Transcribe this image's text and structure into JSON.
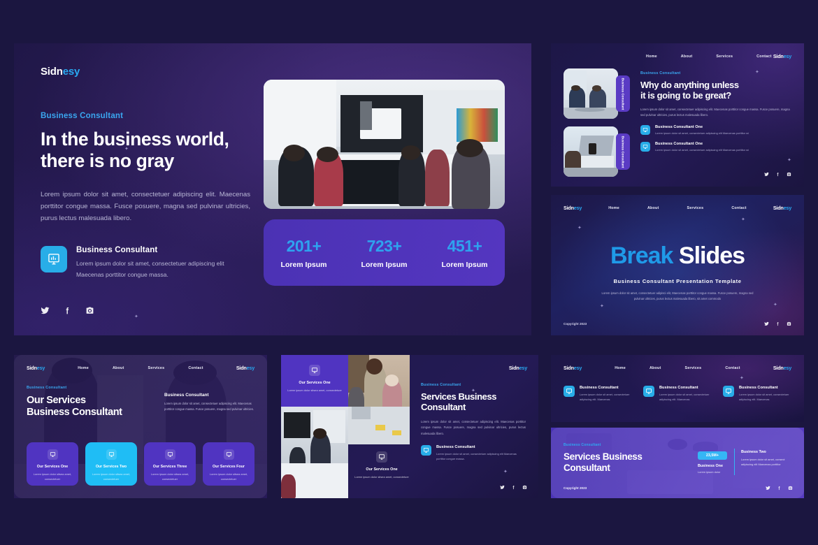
{
  "brand": {
    "logo_prefix": "Sidn",
    "logo_suffix": "esy",
    "accent": "#29a9f2",
    "purple": "#5034c1",
    "bg": "#1b1640"
  },
  "nav": {
    "items": [
      "Home",
      "About",
      "Services",
      "Contact"
    ]
  },
  "hero": {
    "logo_prefix": "Sidn",
    "logo_suffix": "esy",
    "eyebrow": "Business Consultant",
    "title_line1": "In the business world,",
    "title_line2": "there is no gray",
    "paragraph": "Lorem ipsum dolor sit amet, consectetuer adipiscing elit. Maecenas porttitor congue massa. Fusce posuere, magna sed pulvinar ultricies, purus lectus malesuada libero.",
    "feature_title": "Business Consultant",
    "feature_desc": "Lorem ipsum dolor sit amet, consectetuer adipiscing elit Maecenas porttitor congue massa.",
    "stats": [
      {
        "number": "201+",
        "label": "Lorem Ipsum"
      },
      {
        "number": "723+",
        "label": "Lorem Ipsum"
      },
      {
        "number": "451+",
        "label": "Lorem Ipsum"
      }
    ],
    "socials": [
      "twitter-icon",
      "facebook-icon",
      "instagram-icon"
    ]
  },
  "why": {
    "eyebrow": "Business Consultant",
    "title_line1": "Why do anything unless",
    "title_line2": "it is going to be great?",
    "paragraph": "Lorem ipsum dolor sit amet, consectetuer adipiscing elit. Maecenas porttitor congue massa. Fusce posuere, magna sed pulvinar ultricies, purus lectus malesuada libero.",
    "tag_label": "Business Consultant",
    "rows": [
      {
        "title": "Business Consultant One",
        "desc": "Lorem ipsum dolor sit amet, consectetuer adipiscing elit Maecenas porttitor wi"
      },
      {
        "title": "Business Consultant One",
        "desc": "Lorem ipsum dolor sit amet, consectetuer adipiscing elit Maecenas porttitor wi"
      }
    ]
  },
  "break": {
    "title_accent": "Break",
    "title_rest": " Slides",
    "subtitle": "Business Consultant Presentation Template",
    "paragraph": "Lorem ipsum dolor sit amet, consectetuer adipisci elit, Maecenas porttitor congue massa. Fusce posuere, magna sed pulvinar ultricies, purus lectus malesuada libero, sit amet commodo",
    "copyright": "Copyright 2023"
  },
  "our_services": {
    "eyebrow": "Business Consultant",
    "title_line1": "Our Services",
    "title_line2": "Business Consultant",
    "side_title": "Business Consultant",
    "side_desc": "Lorem ipsum dolor sit amet, consectetuer adipiscing elit. Maecenas porttitor congue massa. Fusce posuere, magna sed pulvinar ultricies.",
    "cards": [
      {
        "title": "Our Services One",
        "desc": "Lorem ipsum dolor sitsea amet, consectetuer",
        "active": false
      },
      {
        "title": "Our Services Two",
        "desc": "Lorem ipsum dolor sitsea amet, consectetuer",
        "active": true
      },
      {
        "title": "Our Services Three",
        "desc": "Lorem ipsum dolor sitsea amet, consectetuer",
        "active": false
      },
      {
        "title": "Our Services Four",
        "desc": "Lorem ipsum dolor sitsea amet, consectetuer",
        "active": false
      }
    ]
  },
  "services_business": {
    "tile_a": {
      "title": "Our Services One",
      "desc": "Lorem ipsum dolor sitsea amet, consectetuer"
    },
    "tile_b": {
      "title": "Our Services One",
      "desc": "Lorem ipsum dolor sitsea amet, consectetuer"
    },
    "eyebrow": "Business Consultant",
    "title_line1": "Services Business",
    "title_line2": "Consultant",
    "paragraph": "Lorem ipsum dolor sit amet, consectetuer adipiscing elit. Maecenas porttitor congue massa. Fusce posuere, magna sed pulvinar ultricies, purus lectus malesuada libero.",
    "row_title": "Business Consultant",
    "row_desc": "Lorem ipsum dolor sit amet, consectetuer adipiscing elit Maecenas porttitor congue massa."
  },
  "three_up": {
    "items": [
      {
        "title": "Business Consultant",
        "desc": "Lorem ipsum dolor sit amet, consectetuer adipiscing elit. Maecenas"
      },
      {
        "title": "Business Consultant",
        "desc": "Lorem ipsum dolor sit amet, consectetuer adipiscing elit. Maecenas"
      },
      {
        "title": "Business Consultant",
        "desc": "Lorem ipsum dolor sit amet, consectetuer adipiscing elit. Maecenas"
      }
    ]
  },
  "banner": {
    "eyebrow": "Business Consultant",
    "title_line1": "Services Business",
    "title_line2": "Consultant",
    "kpi_pill": "23,5M+",
    "kpi_title": "Business One",
    "kpi_desc": "Lorem ipsum dolor",
    "kpi2_title": "Business Two",
    "kpi2_desc": "Lorem ipsum dolor sit amet, consect adipiscing elit Maecenas porttitor",
    "copyright": "Copyright 2023"
  }
}
